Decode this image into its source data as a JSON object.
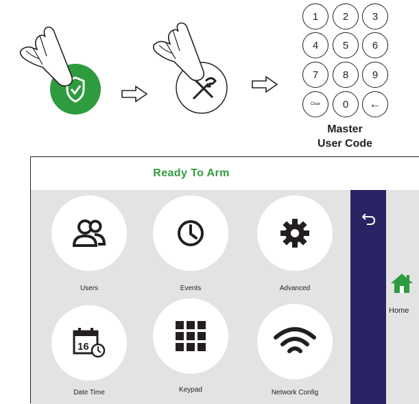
{
  "instructions": {
    "arrow_icon": "right-arrow-outline",
    "keypad": {
      "keys": [
        "1",
        "2",
        "3",
        "4",
        "5",
        "6",
        "7",
        "8",
        "9",
        "Clear",
        "0",
        "←"
      ]
    },
    "caption_line1": "Master",
    "caption_line2": "User Code"
  },
  "panel": {
    "status_text": "Ready To Arm",
    "status_color": "#2e9b3f",
    "tiles": [
      {
        "label": "Users",
        "icon": "users-icon"
      },
      {
        "label": "Events",
        "icon": "clock-icon"
      },
      {
        "label": "Advanced",
        "icon": "gear-icon"
      },
      {
        "label": "Date Time",
        "icon": "calendar-icon"
      },
      {
        "label": "Keypad",
        "icon": "keypad-grid-icon"
      },
      {
        "label": "Network Config",
        "icon": "wifi-icon"
      }
    ],
    "sidebar": {
      "back_icon": "back-arrow-icon",
      "home_label": "Home",
      "home_icon_color": "#2e9b3f",
      "color": "#2a2464"
    }
  }
}
